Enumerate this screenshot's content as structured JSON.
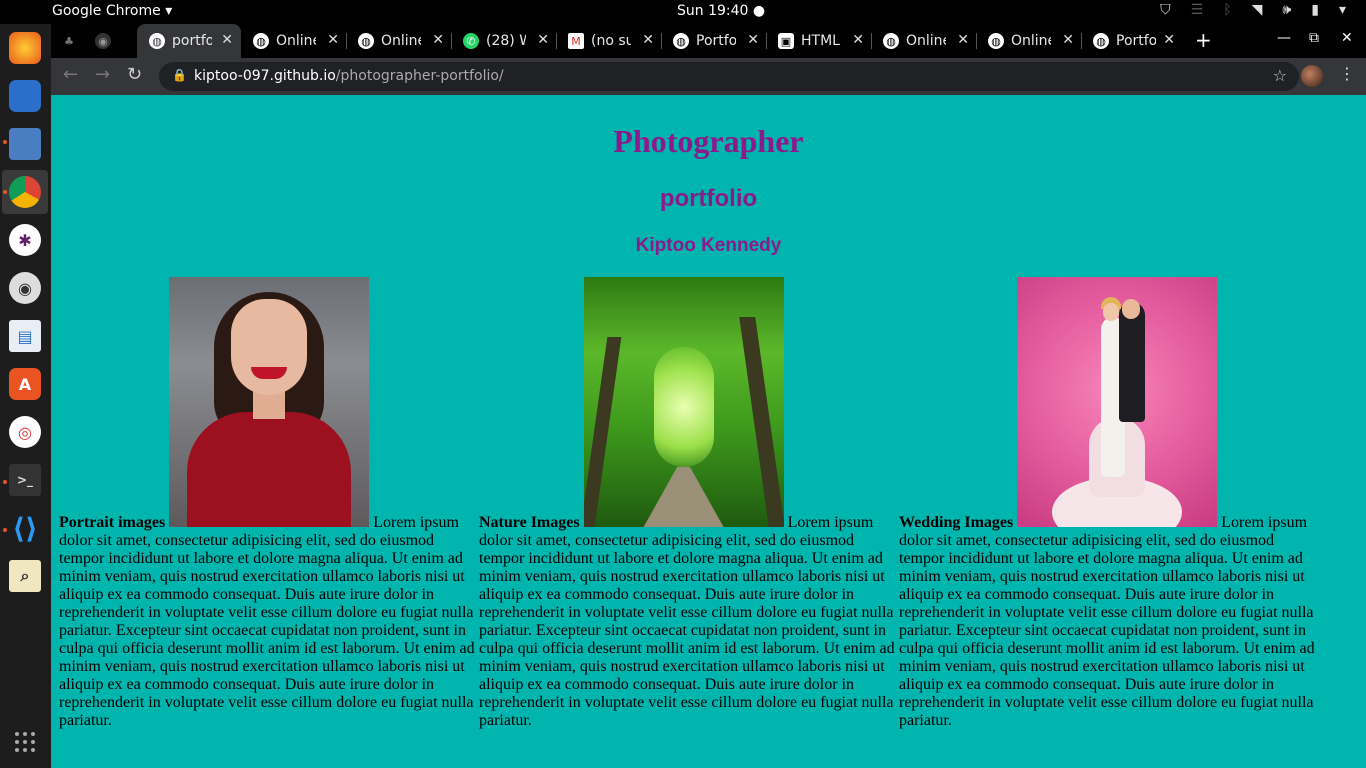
{
  "system_bar": {
    "app_name": "Google Chrome",
    "app_menu_caret": "▾",
    "clock": "Sun 19:40 ●"
  },
  "tabs": [
    {
      "label": "",
      "icon": "tree-icon",
      "active": false
    },
    {
      "label": "",
      "icon": "github-icon",
      "active": false
    },
    {
      "label": "portfolio",
      "icon": "globe-icon",
      "active": true
    },
    {
      "label": "Online",
      "icon": "globe-icon",
      "active": false
    },
    {
      "label": "Online",
      "icon": "globe-icon",
      "active": false
    },
    {
      "label": "(28) W",
      "icon": "whatsapp-icon",
      "active": false
    },
    {
      "label": "(no su",
      "icon": "gmail-icon",
      "active": false
    },
    {
      "label": "Portfo",
      "icon": "globe-icon",
      "active": false
    },
    {
      "label": "HTML",
      "icon": "doc-icon",
      "active": false
    },
    {
      "label": "Online",
      "icon": "globe-icon",
      "active": false
    },
    {
      "label": "Online",
      "icon": "globe-icon",
      "active": false
    },
    {
      "label": "Portfo",
      "icon": "globe-icon",
      "active": false
    }
  ],
  "address_bar": {
    "domain": "kiptoo-097.github.io",
    "path": "/photographer-portfolio/"
  },
  "page": {
    "title": "Photographer",
    "subtitle": "portfolio",
    "author": "Kiptoo Kennedy",
    "sections": [
      {
        "heading": "Portrait images",
        "image": "portrait-photo",
        "text": "Lorem ipsum dolor sit amet, consectetur adipisicing elit, sed do eiusmod tempor incididunt ut labore et dolore magna aliqua. Ut enim ad minim veniam, quis nostrud exercitation ullamco laboris nisi ut aliquip ex ea commodo consequat. Duis aute irure dolor in reprehenderit in voluptate velit esse cillum dolore eu fugiat nulla pariatur. Excepteur sint occaecat cupidatat non proident, sunt in culpa qui officia deserunt mollit anim id est laborum. Ut enim ad minim veniam, quis nostrud exercitation ullamco laboris nisi ut aliquip ex ea commodo consequat. Duis aute irure dolor in reprehenderit in voluptate velit esse cillum dolore eu fugiat nulla pariatur."
      },
      {
        "heading": "Nature Images",
        "image": "forest-path-photo",
        "text": "Lorem ipsum dolor sit amet, consectetur adipisicing elit, sed do eiusmod tempor incididunt ut labore et dolore magna aliqua. Ut enim ad minim veniam, quis nostrud exercitation ullamco laboris nisi ut aliquip ex ea commodo consequat. Duis aute irure dolor in reprehenderit in voluptate velit esse cillum dolore eu fugiat nulla pariatur. Excepteur sint occaecat cupidatat non proident, sunt in culpa qui officia deserunt mollit anim id est laborum. Ut enim ad minim veniam, quis nostrud exercitation ullamco laboris nisi ut aliquip ex ea commodo consequat. Duis aute irure dolor in reprehenderit in voluptate velit esse cillum dolore eu fugiat nulla pariatur."
      },
      {
        "heading": "Wedding Images",
        "image": "wedding-cake-topper-photo",
        "text": "Lorem ipsum dolor sit amet, consectetur adipisicing elit, sed do eiusmod tempor incididunt ut labore et dolore magna aliqua. Ut enim ad minim veniam, quis nostrud exercitation ullamco laboris nisi ut aliquip ex ea commodo consequat. Duis aute irure dolor in reprehenderit in voluptate velit esse cillum dolore eu fugiat nulla pariatur. Excepteur sint occaecat cupidatat non proident, sunt in culpa qui officia deserunt mollit anim id est laborum. Ut enim ad minim veniam, quis nostrud exercitation ullamco laboris nisi ut aliquip ex ea commodo consequat. Duis aute irure dolor in reprehenderit in voluptate velit esse cillum dolore eu fugiat nulla pariatur."
      }
    ]
  },
  "colors": {
    "page_background": "#00b5ad",
    "heading": "#8b1a8b",
    "chrome_toolbar": "#35363a"
  }
}
